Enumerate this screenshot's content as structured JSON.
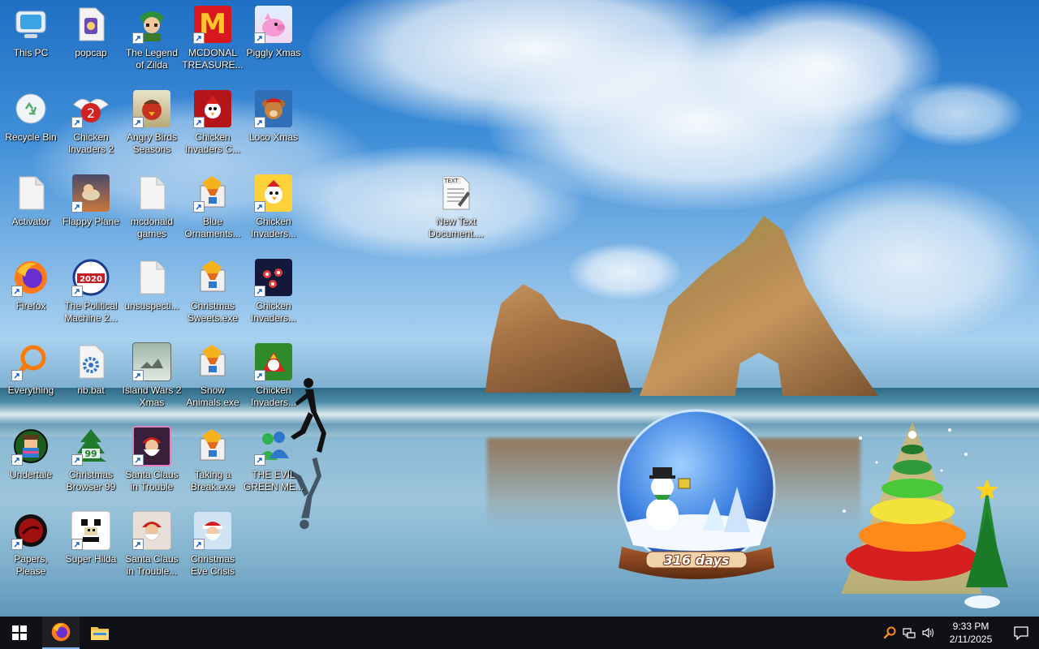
{
  "desktop": {
    "icons": [
      {
        "id": "this-pc",
        "label": "This PC"
      },
      {
        "id": "popcap",
        "label": "popcap"
      },
      {
        "id": "legend-of-zilda",
        "label": "The Legend of Zilda"
      },
      {
        "id": "mcdonald-treasure",
        "label": "MCDONAL TREASURE..."
      },
      {
        "id": "piggly-xmas",
        "label": "Piggly Xmas"
      },
      {
        "id": "recycle-bin",
        "label": "Recycle Bin"
      },
      {
        "id": "chicken-invaders-2",
        "label": "Chicken Invaders 2"
      },
      {
        "id": "angry-birds-seasons",
        "label": "Angry Birds Seasons"
      },
      {
        "id": "chicken-invaders-c",
        "label": "Chicken Invaders C..."
      },
      {
        "id": "loco-xmas",
        "label": "Loco Xmas"
      },
      {
        "id": "activator",
        "label": "Activator"
      },
      {
        "id": "flappy-plane",
        "label": "Flappy Plane"
      },
      {
        "id": "mcdonald-games",
        "label": "mcdonald games"
      },
      {
        "id": "blue-ornaments",
        "label": "Blue Ornaments..."
      },
      {
        "id": "chicken-invaders-a",
        "label": "Chicken Invaders..."
      },
      {
        "id": "new-text-document",
        "label": "New Text Document...."
      },
      {
        "id": "firefox",
        "label": "Firefox"
      },
      {
        "id": "political-machine",
        "label": "The Political Machine 2..."
      },
      {
        "id": "unsuspecti",
        "label": "unsuspecti..."
      },
      {
        "id": "christmas-sweets",
        "label": "Christmas Sweets.exe"
      },
      {
        "id": "chicken-invaders-b",
        "label": "Chicken Invaders..."
      },
      {
        "id": "everything",
        "label": "Everything"
      },
      {
        "id": "nb-bat",
        "label": "nb.bat"
      },
      {
        "id": "island-wars-2",
        "label": "Island Wars 2 Xmas"
      },
      {
        "id": "snow-animals",
        "label": "Snow Animals.exe"
      },
      {
        "id": "chicken-invaders-d",
        "label": "Chicken Invaders..."
      },
      {
        "id": "undertale",
        "label": "Undertale"
      },
      {
        "id": "christmas-browser-99",
        "label": "Christmas Browser 99"
      },
      {
        "id": "santa-claus-trouble",
        "label": "Santa Claus in Trouble"
      },
      {
        "id": "taking-a-break",
        "label": "Taking a Break.exe"
      },
      {
        "id": "evil-green-me",
        "label": "THE EVIL GREEN ME..."
      },
      {
        "id": "papers-please",
        "label": "Papers, Please"
      },
      {
        "id": "super-hilda",
        "label": "Super Hilda"
      },
      {
        "id": "santa-claus-trouble-2",
        "label": "Santa Claus in Trouble..."
      },
      {
        "id": "christmas-eve-crisis",
        "label": "Christmas Eve Crisis"
      }
    ]
  },
  "icon_texts": {
    "mcdonald_logo": "M",
    "political_2020": "2020",
    "browser_99": "99",
    "text_doc": "TEXT"
  },
  "widgets": {
    "countdown": {
      "label": "316 days"
    }
  },
  "taskbar": {
    "start_label": "Start",
    "pinned": [
      {
        "id": "firefox",
        "label": "Firefox"
      },
      {
        "id": "file-explorer",
        "label": "File Explorer"
      }
    ],
    "clock": {
      "time": "9:33 PM",
      "date": "2/11/2025"
    }
  },
  "colors": {
    "taskbar": "#0f1116",
    "label_text": "#ffffff",
    "accent": "#7eb4ea"
  }
}
